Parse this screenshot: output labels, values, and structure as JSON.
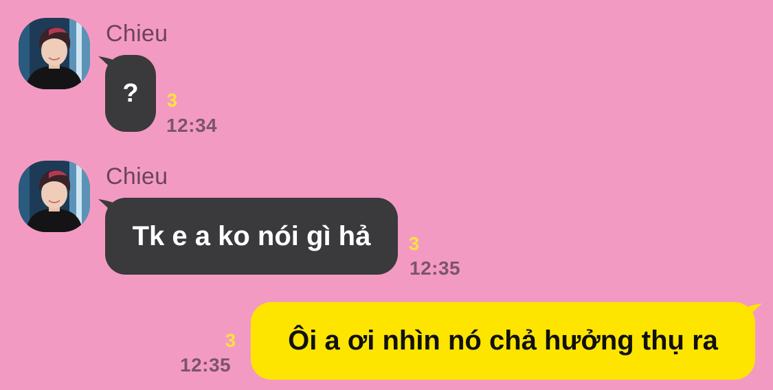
{
  "theme": {
    "background": "#f39ac3",
    "incoming_bubble": "#3a393c",
    "outgoing_bubble": "#fee500",
    "unread_color": "#fde33a",
    "meta_color": "#7b5568"
  },
  "messages": [
    {
      "direction": "incoming",
      "sender": "Chieu",
      "avatar_icon": "profile-photo-icon",
      "text": "?",
      "unread": "3",
      "time": "12:34"
    },
    {
      "direction": "incoming",
      "sender": "Chieu",
      "avatar_icon": "profile-photo-icon",
      "text": "Tk e a ko nói gì hả",
      "unread": "3",
      "time": "12:35"
    },
    {
      "direction": "outgoing",
      "text": "Ôi a ơi nhìn nó chả hưởng thụ ra",
      "unread": "3",
      "time": "12:35"
    }
  ]
}
